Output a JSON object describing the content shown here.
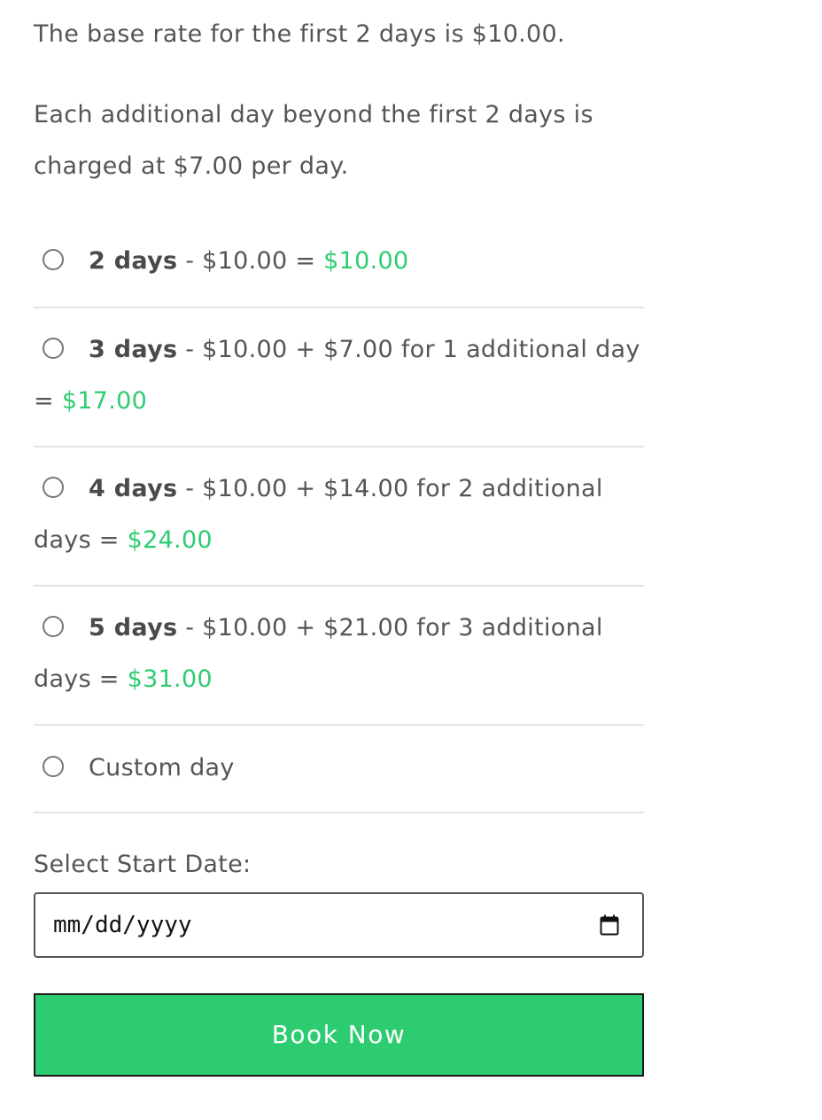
{
  "intro": {
    "base_rate": "The base rate for the first 2 days is $10.00.",
    "additional": "Each additional day beyond the first 2 days is charged at $7.00 per day."
  },
  "options": [
    {
      "days": "2 days",
      "formula": " - $10.00 = ",
      "total": "$10.00"
    },
    {
      "days": "3 days",
      "formula": " - $10.00 + $7.00 for 1 additional day = ",
      "total": "$17.00"
    },
    {
      "days": "4 days",
      "formula": " - $10.00 + $14.00 for 2 additional days = ",
      "total": "$24.00"
    },
    {
      "days": "5 days",
      "formula": " - $10.00 + $21.00 for 3 additional days = ",
      "total": "$31.00"
    },
    {
      "label": "Custom day"
    }
  ],
  "date": {
    "label": "Select Start Date:",
    "placeholder": "mm/dd/yyyy",
    "icon": "calendar-icon"
  },
  "book_button": {
    "label": "Book Now"
  },
  "colors": {
    "accent": "#2ecc71",
    "text": "#555555",
    "divider": "#e4e4e4"
  }
}
